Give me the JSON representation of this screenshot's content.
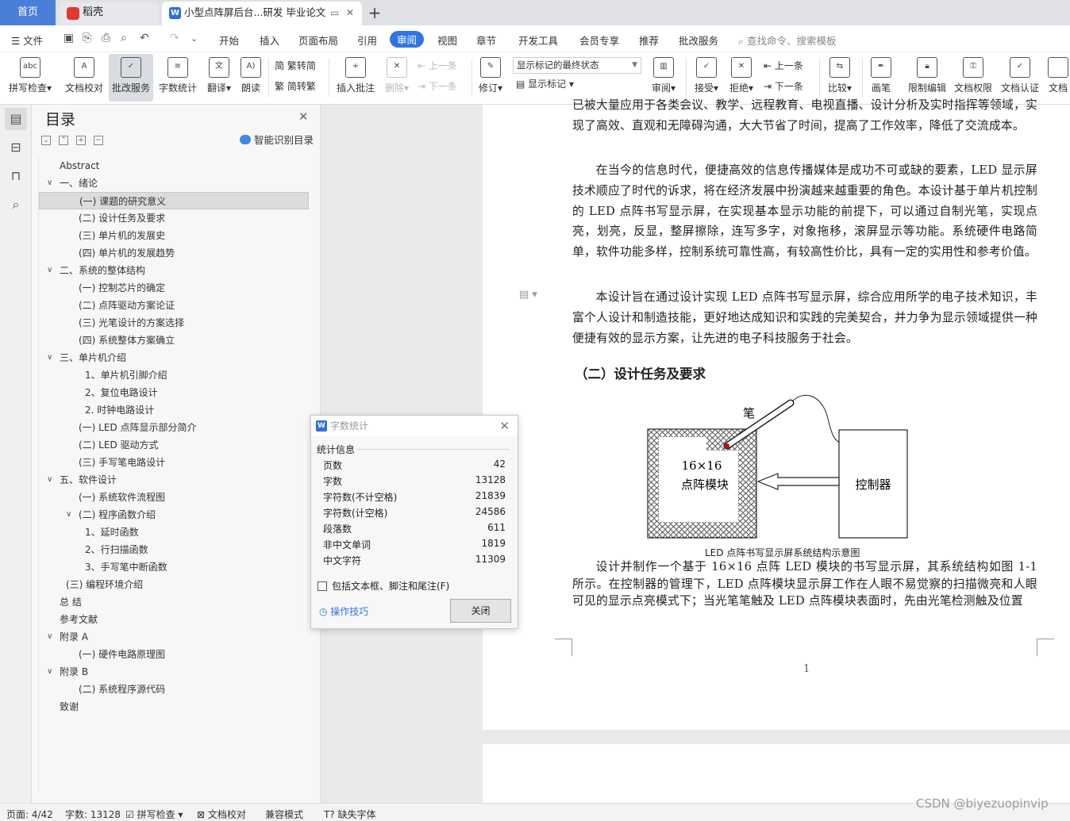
{
  "tabs": {
    "home": "首页",
    "daoke": "稻壳",
    "doc": "小型点阵屏后台...研发 毕业论文"
  },
  "menu": {
    "file": "文件",
    "items": [
      "开始",
      "插入",
      "页面布局",
      "引用",
      "审阅",
      "视图",
      "章节",
      "开发工具",
      "会员专享",
      "推荐",
      "批改服务"
    ],
    "active_index": 4,
    "search": "查找命令、搜索模板"
  },
  "ribbon": {
    "spell": "拼写检查",
    "doccheck": "文档校对",
    "correct": "批改服务",
    "wordcount": "字数统计",
    "translate": "翻译",
    "read": "朗读",
    "trad": "繁转简",
    "simp": "简转繁",
    "insert_comment": "插入批注",
    "delete": "删除",
    "prev1": "上一条",
    "next1": "下一条",
    "revise": "修订",
    "markup_state": "显示标记的最终状态",
    "show_markup": "显示标记",
    "review": "审阅",
    "accept": "接受",
    "reject": "拒绝",
    "prev2": "上一条",
    "next2": "下一条",
    "compare": "比较",
    "pen": "画笔",
    "restrict": "限制编辑",
    "perm": "文档权限",
    "auth": "文档认证",
    "more": "文档"
  },
  "toc": {
    "title": "目录",
    "smart": "智能识别目录",
    "items": [
      {
        "label": "Abstract",
        "level": 0,
        "chev": ""
      },
      {
        "label": "一、绪论",
        "level": 0,
        "chev": "v"
      },
      {
        "label": "(一) 课题的研究意义",
        "level": 1,
        "chev": "",
        "selected": true
      },
      {
        "label": "(二) 设计任务及要求",
        "level": 1,
        "chev": ""
      },
      {
        "label": "(三) 单片机的发展史",
        "level": 1,
        "chev": ""
      },
      {
        "label": "(四) 单片机的发展趋势",
        "level": 1,
        "chev": ""
      },
      {
        "label": "二、系统的整体结构",
        "level": 0,
        "chev": "v"
      },
      {
        "label": "(一) 控制芯片的确定",
        "level": 1,
        "chev": ""
      },
      {
        "label": "(二) 点阵驱动方案论证",
        "level": 1,
        "chev": ""
      },
      {
        "label": "(三) 光笔设计的方案选择",
        "level": 1,
        "chev": ""
      },
      {
        "label": "(四) 系统整体方案确立",
        "level": 1,
        "chev": ""
      },
      {
        "label": "三、单片机介绍",
        "level": 0,
        "chev": "v"
      },
      {
        "label": "1、单片机引脚介绍",
        "level": 2,
        "chev": ""
      },
      {
        "label": "2、复位电路设计",
        "level": 2,
        "chev": ""
      },
      {
        "label": "2. 时钟电路设计",
        "level": 2,
        "chev": ""
      },
      {
        "label": "(一)  LED 点阵显示部分简介",
        "level": 1,
        "chev": ""
      },
      {
        "label": "(二) LED 驱动方式",
        "level": 1,
        "chev": ""
      },
      {
        "label": "(三) 手写笔电路设计",
        "level": 1,
        "chev": ""
      },
      {
        "label": "五、软件设计",
        "level": 0,
        "chev": "v"
      },
      {
        "label": "(一) 系统软件流程图",
        "level": 1,
        "chev": ""
      },
      {
        "label": "(二) 程序函数介绍",
        "level": 1,
        "chev": "v"
      },
      {
        "label": "1、延时函数",
        "level": 2,
        "chev": ""
      },
      {
        "label": "2、行扫描函数",
        "level": 2,
        "chev": ""
      },
      {
        "label": "3、手写笔中断函数",
        "level": 2,
        "chev": ""
      },
      {
        "label": "(三) 编程环境介绍",
        "level": 3,
        "chev": ""
      },
      {
        "label": "总  结",
        "level": 0,
        "chev": ""
      },
      {
        "label": "参考文献",
        "level": 0,
        "chev": ""
      },
      {
        "label": "附录 A",
        "level": 0,
        "chev": "v"
      },
      {
        "label": "(一) 硬件电路原理图",
        "level": 1,
        "chev": ""
      },
      {
        "label": "附录 B",
        "level": 0,
        "chev": "v"
      },
      {
        "label": "(二) 系统程序源代码",
        "level": 1,
        "chev": ""
      },
      {
        "label": "致谢",
        "level": 0,
        "chev": ""
      }
    ]
  },
  "document": {
    "p0": "已被大量应用于各类会议、教学、远程教育、电视直播、设计分析及实时指挥等领域，实现了高效、直观和无障碍沟通，大大节省了时间，提高了工作效率，降低了交流成本。",
    "p1": "在当今的信息时代，便捷高效的信息传播媒体是成功不可或缺的要素，LED 显示屏技术顺应了时代的诉求，将在经济发展中扮演越来越重要的角色。本设计基于单片机控制的 LED 点阵书写显示屏，在实现基本显示功能的前提下，可以通过自制光笔，实现点亮，划亮，反显，整屏擦除，连写多字，对象拖移，滚屏显示等功能。系统硬件电路简单，软件功能多样，控制系统可靠性高，有较高性价比，具有一定的实用性和参考价值。",
    "p2": "本设计旨在通过设计实现 LED 点阵书写显示屏，综合应用所学的电子技术知识，丰富个人设计和制造技能，更好地达成知识和实践的完美契合，并力争为显示领域提供一种便捷有效的显示方案，让先进的电子科技服务于社会。",
    "heading": "（二）设计任务及要求",
    "fig_pen": "笔",
    "fig_module_1": "16×16",
    "fig_module_2": "点阵模块",
    "fig_controller": "控制器",
    "caption": "LED 点阵书写显示屏系统结构示意图",
    "p3": "设计并制作一个基于 16×16 点阵 LED 模块的书写显示屏，其系统结构如图 1-1 所示。在控制器的管理下，LED 点阵模块显示屏工作在人眼不易觉察的扫描微亮和人眼可见的显示点亮模式下；当光笔笔触及 LED 点阵模块表面时，先由光笔检测触及位置",
    "page_number": "1"
  },
  "dialog": {
    "title": "字数统计",
    "group": "统计信息",
    "rows": [
      {
        "k": "页数",
        "v": "42"
      },
      {
        "k": "字数",
        "v": "13128"
      },
      {
        "k": "字符数(不计空格)",
        "v": "21839"
      },
      {
        "k": "字符数(计空格)",
        "v": "24586"
      },
      {
        "k": "段落数",
        "v": "611"
      },
      {
        "k": "非中文单词",
        "v": "1819"
      },
      {
        "k": "中文字符",
        "v": "11309"
      }
    ],
    "include": "包括文本框、脚注和尾注(F)",
    "tips": "操作技巧",
    "close": "关闭"
  },
  "status": {
    "page": "页面: 4/42",
    "words": "字数: 13128",
    "spell": "拼写检查",
    "doccheck": "文档校对",
    "compat": "兼容模式",
    "missing_font": "缺失字体"
  },
  "watermark": "CSDN @biyezuopinvip"
}
